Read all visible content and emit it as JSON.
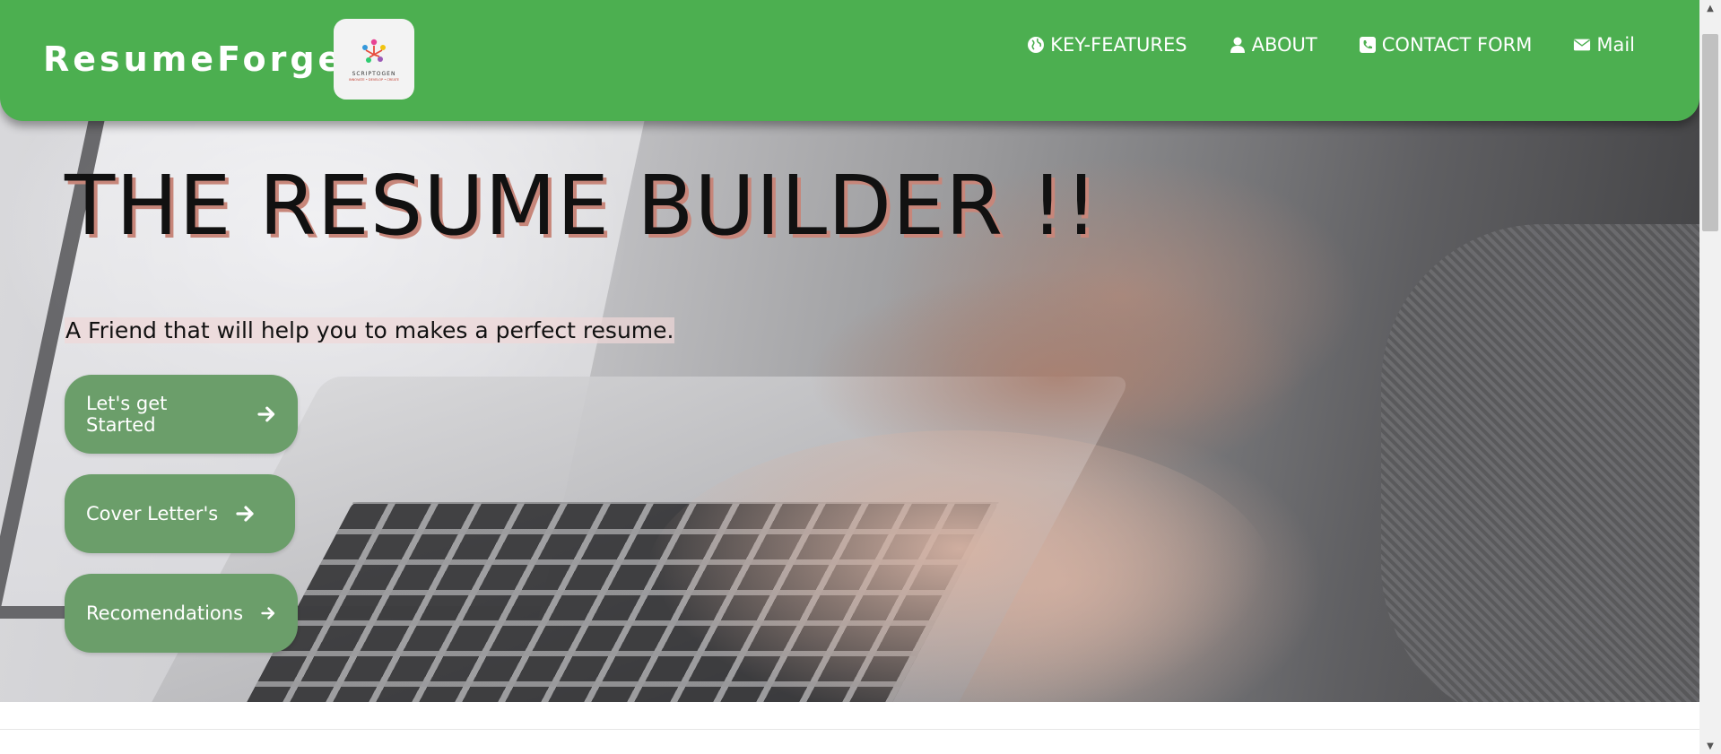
{
  "navbar": {
    "brand": "ResumeForge",
    "logo": {
      "text": "SCRIPTOGEN",
      "subtext": "INNOVATE • DEVELOP • CREATE"
    },
    "links": [
      {
        "label": "KEY-FEATURES",
        "icon": "globe-icon"
      },
      {
        "label": "ABOUT",
        "icon": "user-icon"
      },
      {
        "label": "CONTACT FORM",
        "icon": "phone-icon"
      },
      {
        "label": "Mail",
        "icon": "envelope-icon"
      }
    ]
  },
  "hero": {
    "headline": "THE RESUME BUILDER !!",
    "tagline": "A Friend that will help you to makes a perfect resume.",
    "buttons": [
      {
        "label": "Let's get Started",
        "icon": "arrow-right-icon"
      },
      {
        "label": "Cover Letter's",
        "icon": "arrow-right-icon"
      },
      {
        "label": "Recomendations",
        "icon": "arrow-right-icon"
      }
    ]
  },
  "colors": {
    "navbar": "#4caf50",
    "button": "#6b9e6a",
    "headline_shadow": "#c7867a"
  }
}
